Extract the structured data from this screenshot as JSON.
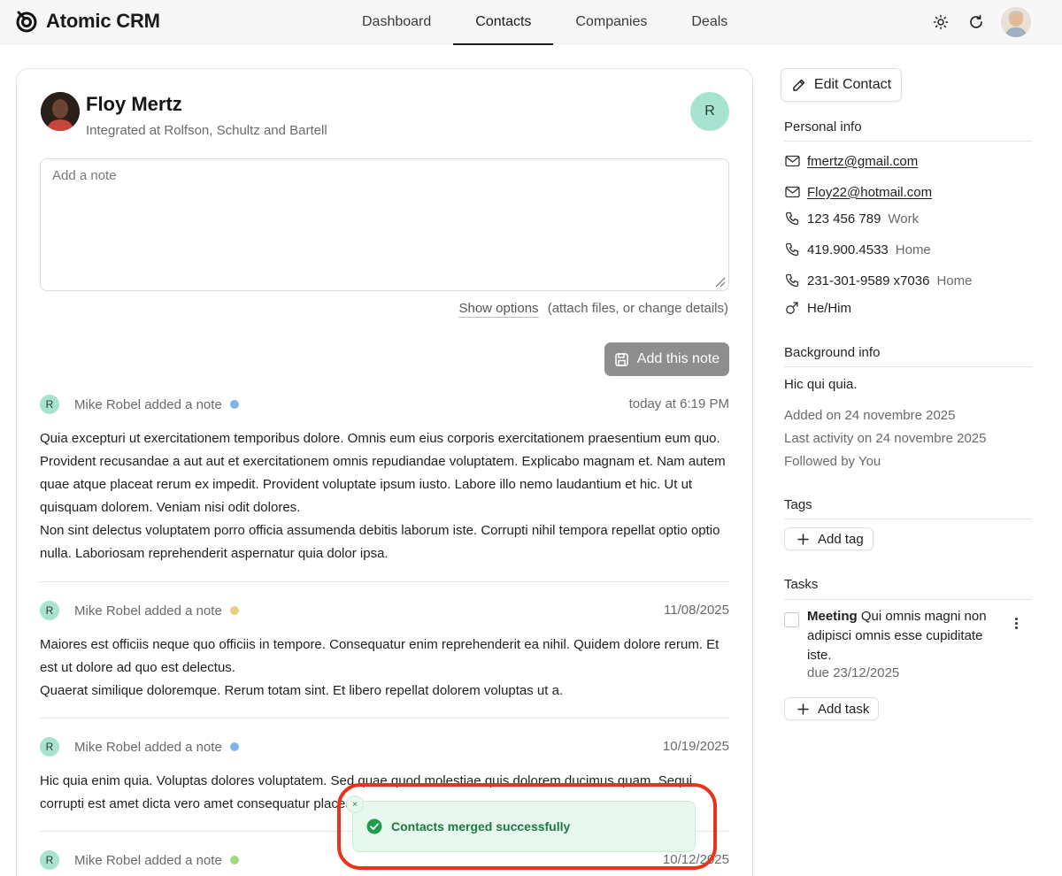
{
  "app": {
    "title": "Atomic CRM",
    "logo_icon": "atomic-logo-icon"
  },
  "nav": {
    "tabs": [
      {
        "label": "Dashboard",
        "active": false
      },
      {
        "label": "Contacts",
        "active": true
      },
      {
        "label": "Companies",
        "active": false
      },
      {
        "label": "Deals",
        "active": false
      }
    ]
  },
  "header_icons": [
    "sun-icon",
    "refresh-icon",
    "avatar"
  ],
  "contact": {
    "name": "Floy Mertz",
    "subtitle": "Integrated at Rolfson, Schultz and Bartell",
    "owner_initial": "R"
  },
  "note_form": {
    "placeholder": "Add a note",
    "show_options": "Show options",
    "options_hint": "(attach files, or change details)",
    "submit_label": "Add this note"
  },
  "notes": [
    {
      "initial": "R",
      "author": "Mike Robel added a note",
      "status_color": "#7fb5e6",
      "date": "today at 6:19 PM",
      "body": "Quia excepturi ut exercitationem temporibus dolore. Omnis eum eius corporis exercitationem praesentium eum quo. Provident recusandae a aut aut et exercitationem omnis repudiandae voluptatem. Explicabo magnam et. Nam autem quae atque placeat rerum ex impedit. Provident voluptate ipsum iusto. Labore illo nemo laudantium et hic. Ut ut quisquam dolorem. Veniam nisi odit dolores.\nNon sint delectus voluptatem porro officia assumenda debitis laborum iste. Corrupti nihil tempora repellat optio optio nulla. Laboriosam reprehenderit aspernatur quia dolor ipsa."
    },
    {
      "initial": "R",
      "author": "Mike Robel added a note",
      "status_color": "#e8cf7a",
      "date": "11/08/2025",
      "body": "Maiores est officiis neque quo officiis in tempore. Consequatur enim reprehenderit ea nihil. Quidem dolore rerum. Et est ut dolore ad quo est delectus.\nQuaerat similique doloremque. Rerum totam sint. Et libero repellat dolorem voluptas ut a."
    },
    {
      "initial": "R",
      "author": "Mike Robel added a note",
      "status_color": "#7fb5e6",
      "date": "10/19/2025",
      "body": "Hic quia enim quia. Voluptas dolores voluptatem. Sed quae quod molestiae quis dolorem ducimus quam. Sequi corrupti est amet dicta vero amet consequatur placeat."
    },
    {
      "initial": "R",
      "author": "Mike Robel added a note",
      "status_color": "#9edc7e",
      "date": "10/12/2025",
      "body": ""
    }
  ],
  "toast": {
    "message": "Contacts merged successfully",
    "close": "×"
  },
  "sidebar": {
    "edit_label": "Edit Contact",
    "personal_info_title": "Personal info",
    "emails": [
      "fmertz@gmail.com",
      "Floy22@hotmail.com"
    ],
    "phones": [
      {
        "number": "123 456 789",
        "type": "Work"
      },
      {
        "number": "419.900.4533",
        "type": "Home"
      },
      {
        "number": "231-301-9589 x7036",
        "type": "Home"
      }
    ],
    "pronouns": "He/Him",
    "background_title": "Background info",
    "background_text": "Hic qui quia.",
    "added_on": "Added on 24 novembre 2025",
    "last_activity": "Last activity on 24 novembre 2025",
    "followed_by": "Followed by You",
    "tags_title": "Tags",
    "add_tag_label": "Add tag",
    "tasks_title": "Tasks",
    "task": {
      "type": "Meeting",
      "text": "Qui omnis magni non adipisci omnis esse cupiditate iste.",
      "due": "due 23/12/2025"
    },
    "add_task_label": "Add task"
  }
}
